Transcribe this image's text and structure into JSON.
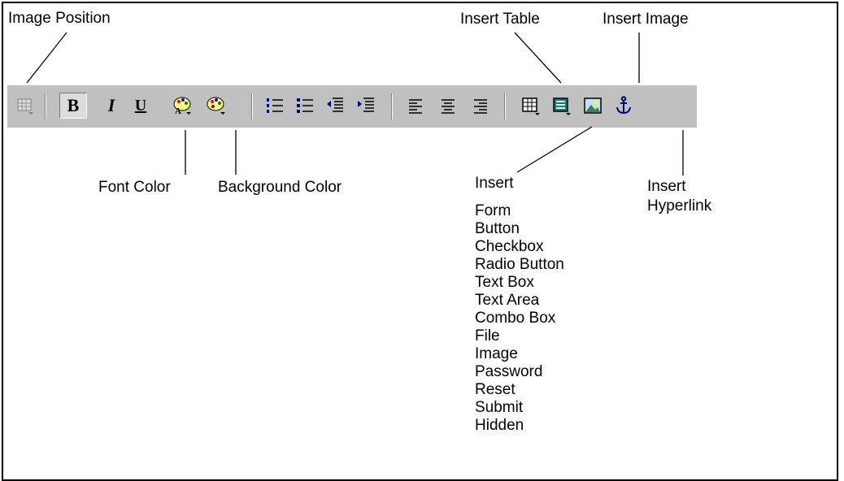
{
  "labels": {
    "image_position": "Image Position",
    "insert_table": "Insert Table",
    "insert_image": "Insert Image",
    "font_color": "Font Color",
    "background_color": "Background Color",
    "insert": "Insert",
    "insert_hyperlink_1": "Insert",
    "insert_hyperlink_2": "Hyperlink"
  },
  "toolbar": {
    "bold": "B",
    "italic": "I",
    "underline": "U",
    "icons": [
      "image-position-icon",
      "bold-icon",
      "italic-icon",
      "underline-icon",
      "font-color-icon",
      "background-color-icon",
      "numbered-list-icon",
      "bulleted-list-icon",
      "outdent-icon",
      "indent-icon",
      "align-left-icon",
      "align-center-icon",
      "align-right-icon",
      "insert-table-icon",
      "insert-form-icon",
      "insert-image-icon",
      "insert-hyperlink-icon"
    ]
  },
  "insert_items": [
    "Form",
    "Button",
    "Checkbox",
    "Radio Button",
    "Text Box",
    "Text Area",
    "Combo Box",
    "File",
    "Image",
    "Password",
    "Reset",
    "Submit",
    "Hidden"
  ],
  "colors": {
    "toolbar_bg": "#c0c0c0",
    "accent_blue": "#000080",
    "teal": "#008080"
  }
}
